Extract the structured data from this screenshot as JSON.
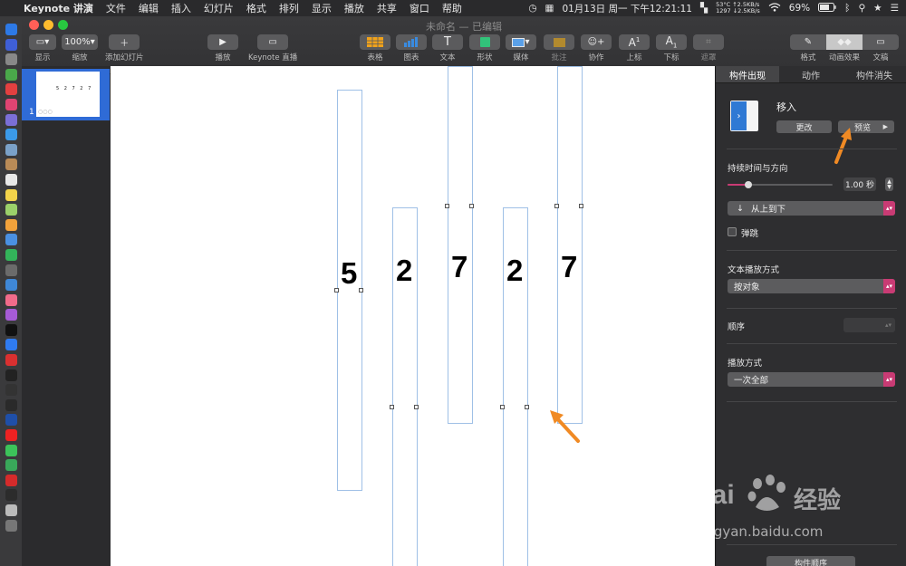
{
  "menubar": {
    "app_name": "Keynote 讲演",
    "menus": [
      "文件",
      "编辑",
      "插入",
      "幻灯片",
      "格式",
      "排列",
      "显示",
      "播放",
      "共享",
      "窗口",
      "帮助"
    ],
    "datetime": "01月13日 周一 下午12:21:11",
    "net": {
      "temp": "53°C",
      "up": "↑2.5KB/s",
      "rpm": "1297",
      "down": "↓2.5KB/s"
    },
    "battery": "69%"
  },
  "window": {
    "title": "未命名 — 已编辑",
    "traffic_colors": [
      "#ff5f57",
      "#febc2e",
      "#28c840"
    ]
  },
  "toolbar": {
    "view_label": "显示",
    "zoom_value": "100%",
    "zoom_label": "缩放",
    "add_slide_label": "添加幻灯片",
    "play_label": "播放",
    "keynote_live_label": "Keynote 直播",
    "table_label": "表格",
    "chart_label": "图表",
    "text_label": "文本",
    "shape_label": "形状",
    "media_label": "媒体",
    "comment_label": "批注",
    "collaborate_label": "协作",
    "superscript_label": "上标",
    "subscript_label": "下标",
    "mask_label": "遮罩",
    "format_label": "格式",
    "animate_label": "动画效果",
    "document_label": "文稿"
  },
  "navigator": {
    "slide_number": "1",
    "thumb_text": "5 2 7 2 7"
  },
  "slide": {
    "digits": [
      "5",
      "2",
      "7",
      "2",
      "7"
    ]
  },
  "inspector": {
    "tabs": [
      "构件出现",
      "动作",
      "构件消失"
    ],
    "effect_name": "移入",
    "change_button": "更改",
    "preview_button": "预览",
    "duration_label": "持续时间与方向",
    "duration_value": "1.00 秒",
    "duration_fraction": 0.2,
    "direction_value": "从上到下",
    "bounce_label": "弹跳",
    "text_delivery_label": "文本播放方式",
    "text_delivery_value": "按对象",
    "order_label": "顺序",
    "playback_label": "播放方式",
    "playback_value": "一次全部",
    "build_order_button": "构件顺序",
    "accent_color": "#c93b74"
  },
  "watermark": {
    "brand": "Bai",
    "brand_cn": "经验",
    "url": "jingyan.baidu.com"
  },
  "annotation_color": "#f08a24"
}
